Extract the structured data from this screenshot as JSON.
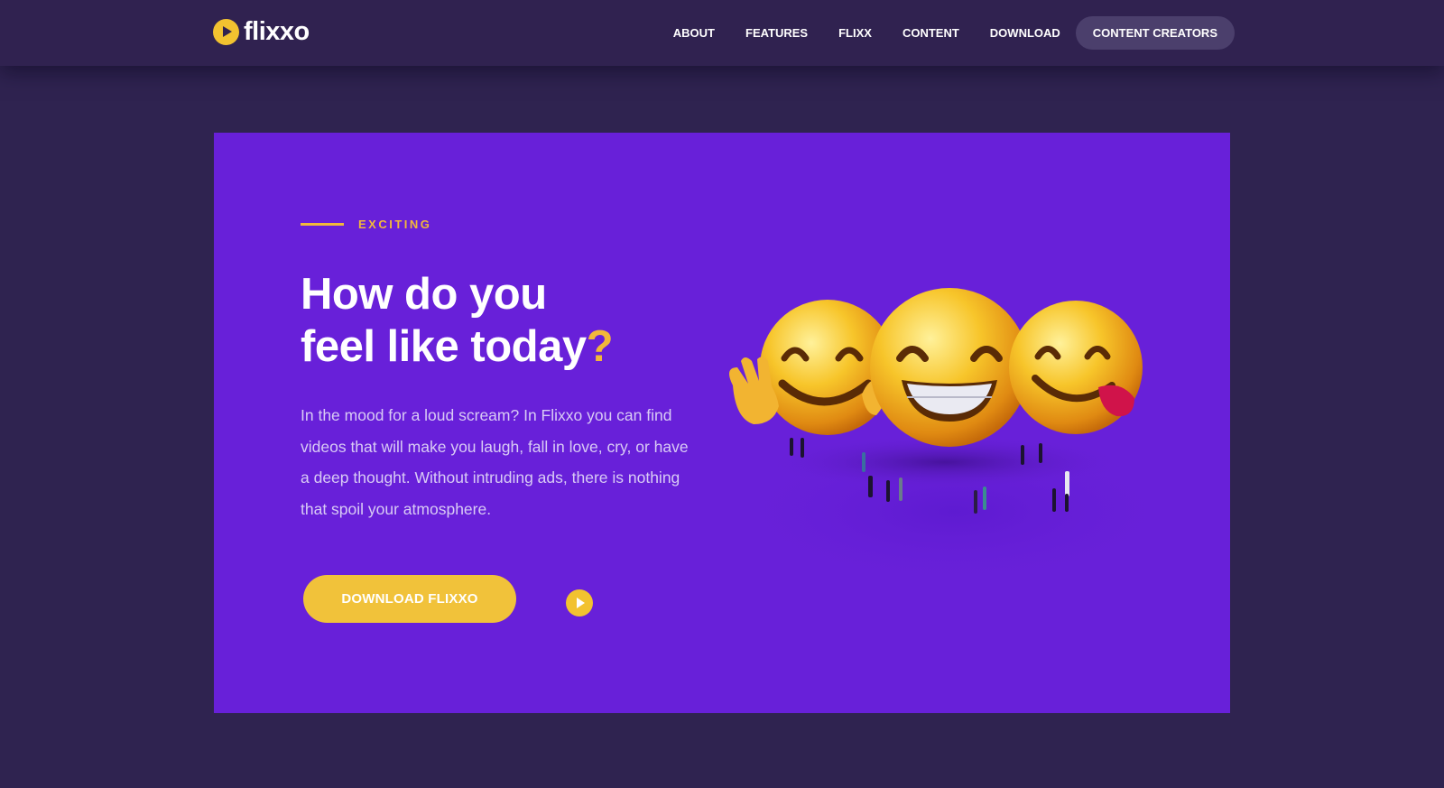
{
  "brand": {
    "name": "flixxo",
    "accent": "#f2c230"
  },
  "nav": {
    "items": [
      "ABOUT",
      "FEATURES",
      "FLIXX",
      "CONTENT",
      "DOWNLOAD"
    ],
    "highlight": "CONTENT CREATORS"
  },
  "hero": {
    "kicker": "EXCITING",
    "headline_line1": "How do you",
    "headline_line2": "feel like today",
    "headline_mark": "?",
    "body": "In the mood for a loud scream? In Flixxo you can find videos that will make you laugh, fall in love, cry, or have a deep thought. Without intruding ads, there is nothing that spoil your atmosphere.",
    "cta_label": "DOWNLOAD FLIXXO",
    "background": "#6820d9"
  },
  "icons": {
    "logo": "play-circle-icon",
    "play": "play-icon",
    "illustration": "emoji-faces-illustration"
  }
}
